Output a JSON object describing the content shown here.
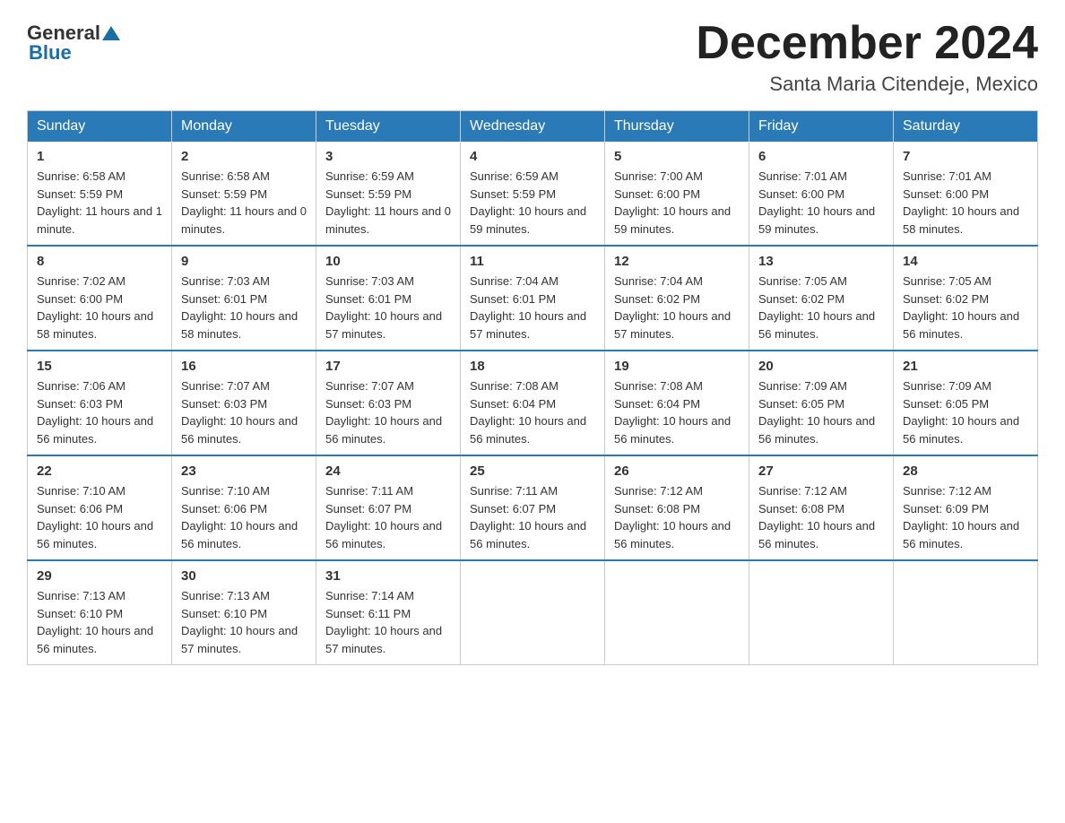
{
  "header": {
    "logo": {
      "general": "General",
      "blue": "Blue"
    },
    "title": "December 2024",
    "location": "Santa Maria Citendeje, Mexico"
  },
  "days_of_week": [
    "Sunday",
    "Monday",
    "Tuesday",
    "Wednesday",
    "Thursday",
    "Friday",
    "Saturday"
  ],
  "weeks": [
    [
      {
        "day": "1",
        "sunrise": "6:58 AM",
        "sunset": "5:59 PM",
        "daylight": "11 hours and 1 minute."
      },
      {
        "day": "2",
        "sunrise": "6:58 AM",
        "sunset": "5:59 PM",
        "daylight": "11 hours and 0 minutes."
      },
      {
        "day": "3",
        "sunrise": "6:59 AM",
        "sunset": "5:59 PM",
        "daylight": "11 hours and 0 minutes."
      },
      {
        "day": "4",
        "sunrise": "6:59 AM",
        "sunset": "5:59 PM",
        "daylight": "10 hours and 59 minutes."
      },
      {
        "day": "5",
        "sunrise": "7:00 AM",
        "sunset": "6:00 PM",
        "daylight": "10 hours and 59 minutes."
      },
      {
        "day": "6",
        "sunrise": "7:01 AM",
        "sunset": "6:00 PM",
        "daylight": "10 hours and 59 minutes."
      },
      {
        "day": "7",
        "sunrise": "7:01 AM",
        "sunset": "6:00 PM",
        "daylight": "10 hours and 58 minutes."
      }
    ],
    [
      {
        "day": "8",
        "sunrise": "7:02 AM",
        "sunset": "6:00 PM",
        "daylight": "10 hours and 58 minutes."
      },
      {
        "day": "9",
        "sunrise": "7:03 AM",
        "sunset": "6:01 PM",
        "daylight": "10 hours and 58 minutes."
      },
      {
        "day": "10",
        "sunrise": "7:03 AM",
        "sunset": "6:01 PM",
        "daylight": "10 hours and 57 minutes."
      },
      {
        "day": "11",
        "sunrise": "7:04 AM",
        "sunset": "6:01 PM",
        "daylight": "10 hours and 57 minutes."
      },
      {
        "day": "12",
        "sunrise": "7:04 AM",
        "sunset": "6:02 PM",
        "daylight": "10 hours and 57 minutes."
      },
      {
        "day": "13",
        "sunrise": "7:05 AM",
        "sunset": "6:02 PM",
        "daylight": "10 hours and 56 minutes."
      },
      {
        "day": "14",
        "sunrise": "7:05 AM",
        "sunset": "6:02 PM",
        "daylight": "10 hours and 56 minutes."
      }
    ],
    [
      {
        "day": "15",
        "sunrise": "7:06 AM",
        "sunset": "6:03 PM",
        "daylight": "10 hours and 56 minutes."
      },
      {
        "day": "16",
        "sunrise": "7:07 AM",
        "sunset": "6:03 PM",
        "daylight": "10 hours and 56 minutes."
      },
      {
        "day": "17",
        "sunrise": "7:07 AM",
        "sunset": "6:03 PM",
        "daylight": "10 hours and 56 minutes."
      },
      {
        "day": "18",
        "sunrise": "7:08 AM",
        "sunset": "6:04 PM",
        "daylight": "10 hours and 56 minutes."
      },
      {
        "day": "19",
        "sunrise": "7:08 AM",
        "sunset": "6:04 PM",
        "daylight": "10 hours and 56 minutes."
      },
      {
        "day": "20",
        "sunrise": "7:09 AM",
        "sunset": "6:05 PM",
        "daylight": "10 hours and 56 minutes."
      },
      {
        "day": "21",
        "sunrise": "7:09 AM",
        "sunset": "6:05 PM",
        "daylight": "10 hours and 56 minutes."
      }
    ],
    [
      {
        "day": "22",
        "sunrise": "7:10 AM",
        "sunset": "6:06 PM",
        "daylight": "10 hours and 56 minutes."
      },
      {
        "day": "23",
        "sunrise": "7:10 AM",
        "sunset": "6:06 PM",
        "daylight": "10 hours and 56 minutes."
      },
      {
        "day": "24",
        "sunrise": "7:11 AM",
        "sunset": "6:07 PM",
        "daylight": "10 hours and 56 minutes."
      },
      {
        "day": "25",
        "sunrise": "7:11 AM",
        "sunset": "6:07 PM",
        "daylight": "10 hours and 56 minutes."
      },
      {
        "day": "26",
        "sunrise": "7:12 AM",
        "sunset": "6:08 PM",
        "daylight": "10 hours and 56 minutes."
      },
      {
        "day": "27",
        "sunrise": "7:12 AM",
        "sunset": "6:08 PM",
        "daylight": "10 hours and 56 minutes."
      },
      {
        "day": "28",
        "sunrise": "7:12 AM",
        "sunset": "6:09 PM",
        "daylight": "10 hours and 56 minutes."
      }
    ],
    [
      {
        "day": "29",
        "sunrise": "7:13 AM",
        "sunset": "6:10 PM",
        "daylight": "10 hours and 56 minutes."
      },
      {
        "day": "30",
        "sunrise": "7:13 AM",
        "sunset": "6:10 PM",
        "daylight": "10 hours and 57 minutes."
      },
      {
        "day": "31",
        "sunrise": "7:14 AM",
        "sunset": "6:11 PM",
        "daylight": "10 hours and 57 minutes."
      },
      null,
      null,
      null,
      null
    ]
  ]
}
